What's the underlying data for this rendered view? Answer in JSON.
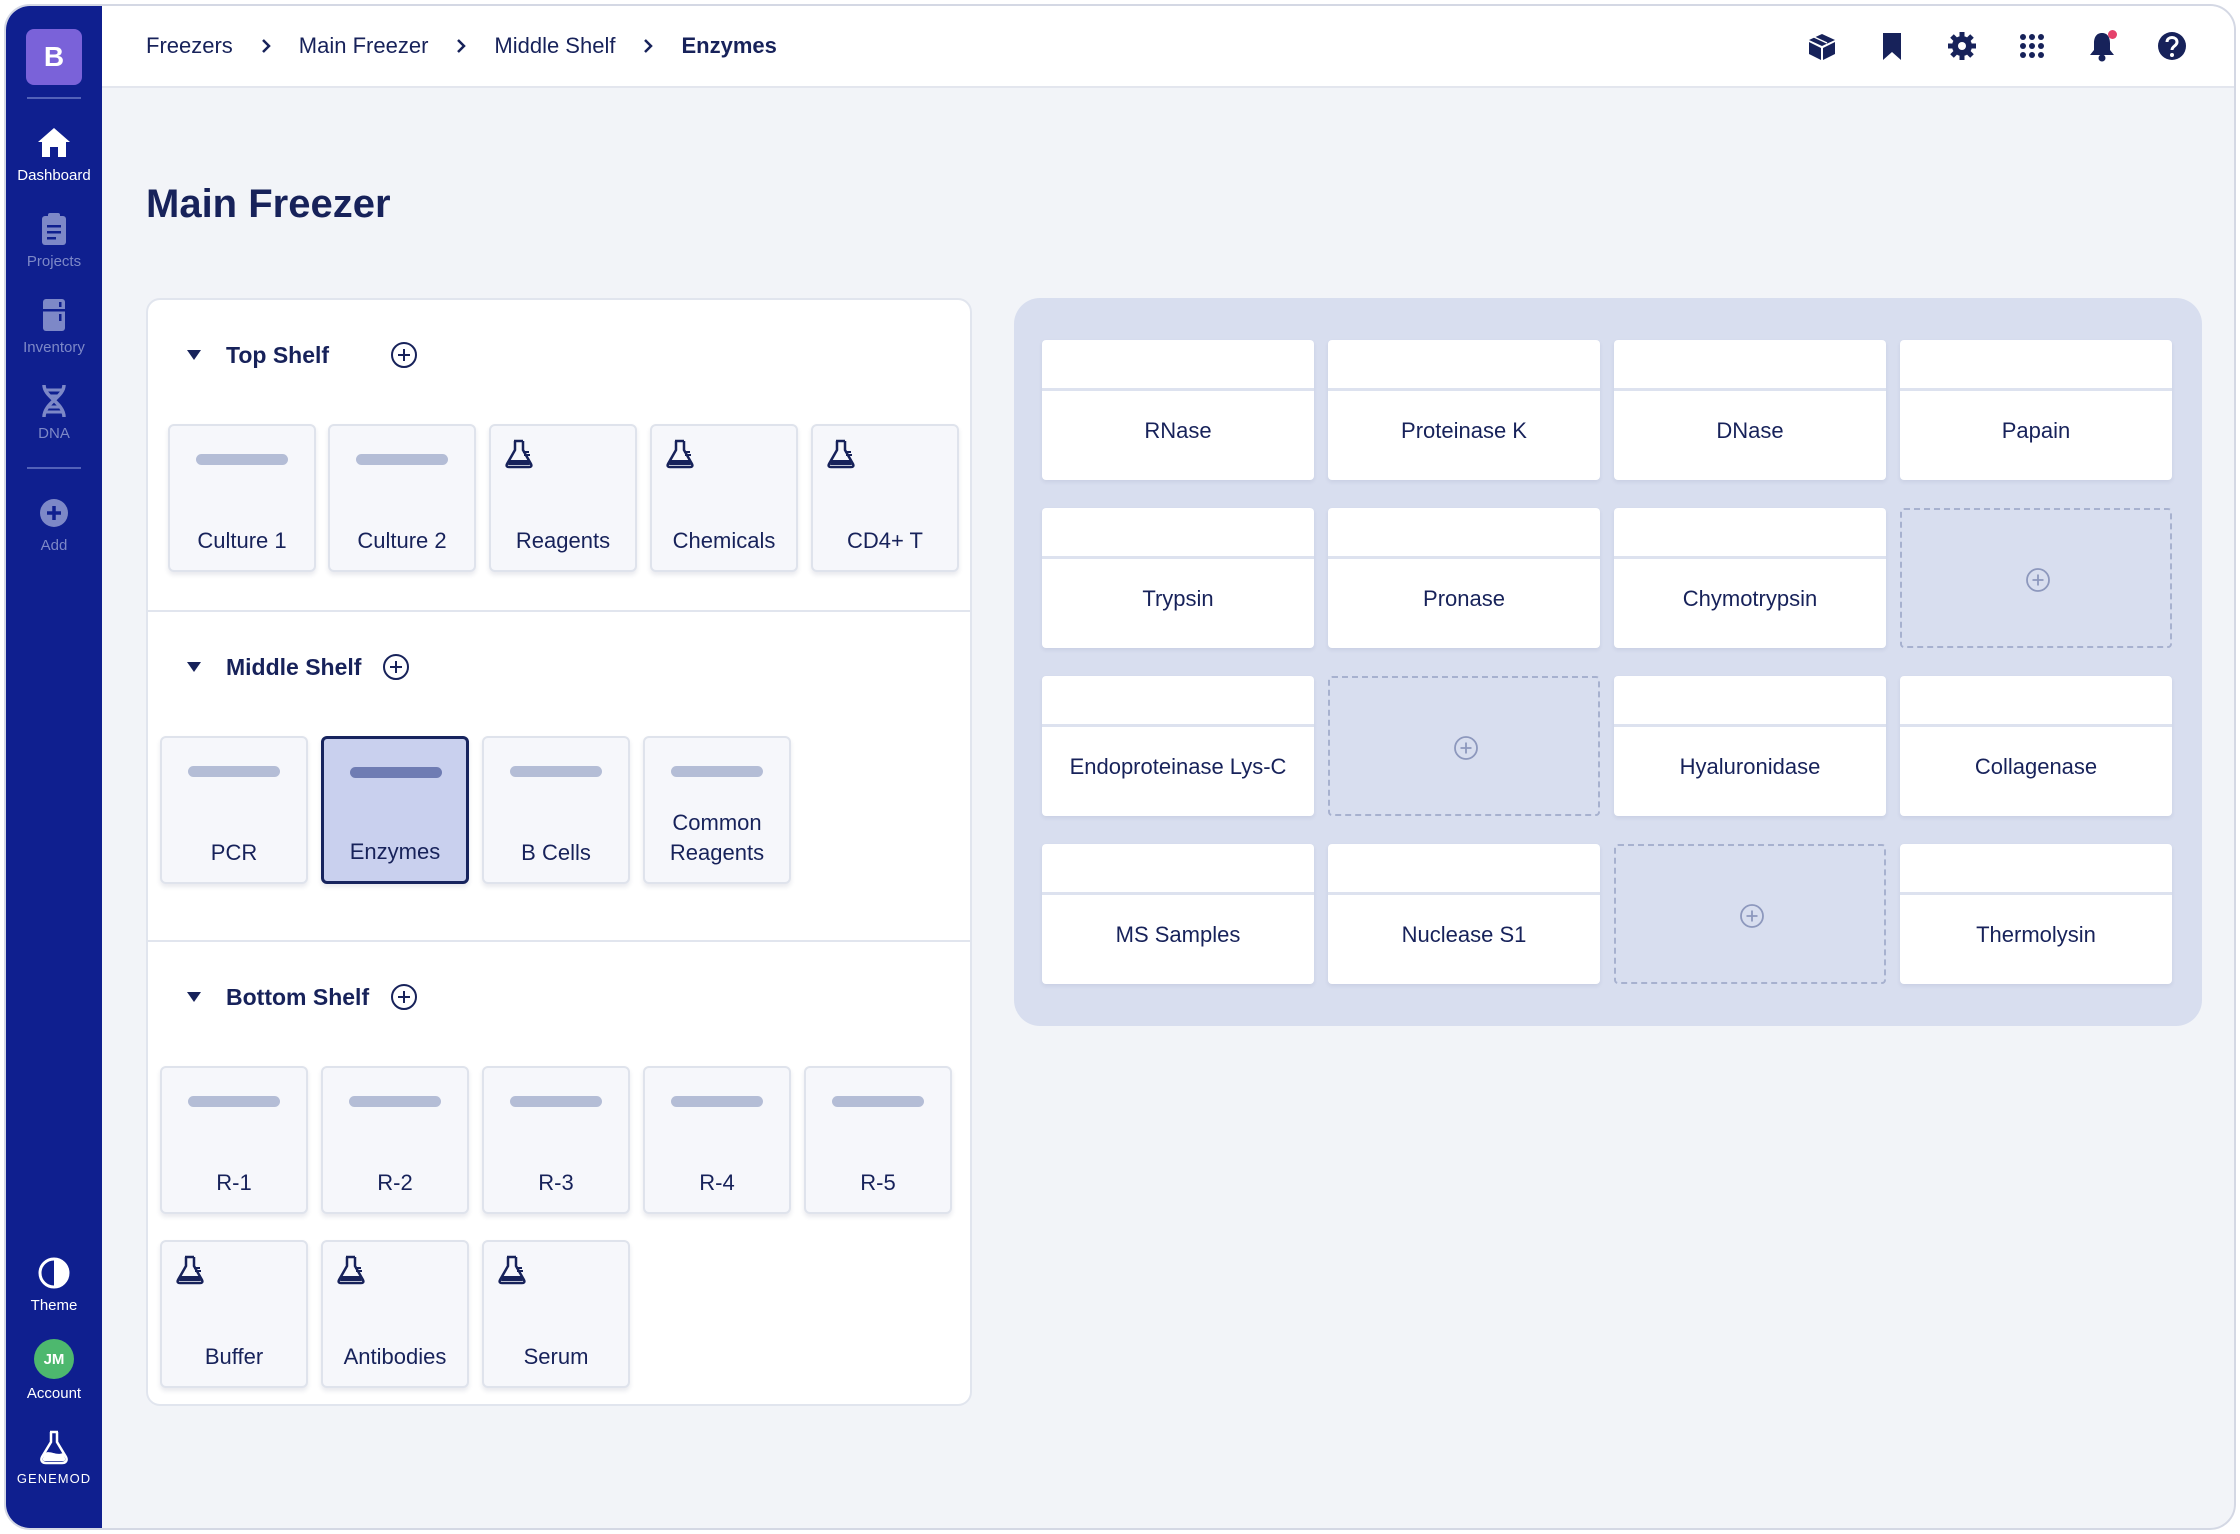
{
  "sidebar": {
    "logo": "B",
    "nav": [
      {
        "id": "dashboard",
        "label": "Dashboard",
        "active": true
      },
      {
        "id": "projects",
        "label": "Projects",
        "active": false
      },
      {
        "id": "inventory",
        "label": "Inventory",
        "active": false
      },
      {
        "id": "dna",
        "label": "DNA",
        "active": false
      },
      {
        "id": "add",
        "label": "Add",
        "active": false
      }
    ],
    "bottom": {
      "theme_label": "Theme",
      "account_initials": "JM",
      "account_label": "Account",
      "brand_label": "GENEMOD"
    }
  },
  "breadcrumb": [
    "Freezers",
    "Main Freezer",
    "Middle Shelf",
    "Enzymes"
  ],
  "header_icons": [
    "box-icon",
    "bookmark-icon",
    "gear-icon",
    "apps-grid-icon",
    "bell-icon",
    "help-icon"
  ],
  "page": {
    "title": "Main Freezer"
  },
  "shelves": [
    {
      "name": "Top Shelf",
      "boxes": [
        {
          "label": "Culture 1",
          "icon": "bar"
        },
        {
          "label": "Culture 2",
          "icon": "bar"
        },
        {
          "label": "Reagents",
          "icon": "flask"
        },
        {
          "label": "Chemicals",
          "icon": "flask"
        },
        {
          "label": "CD4+ T",
          "icon": "flask"
        }
      ]
    },
    {
      "name": "Middle Shelf",
      "boxes": [
        {
          "label": "PCR",
          "icon": "bar"
        },
        {
          "label": "Enzymes",
          "icon": "bar",
          "selected": true
        },
        {
          "label": "B Cells",
          "icon": "bar"
        },
        {
          "label": "Common Reagents",
          "icon": "bar"
        }
      ]
    },
    {
      "name": "Bottom Shelf",
      "boxes": [
        {
          "label": "R-1",
          "icon": "bar"
        },
        {
          "label": "R-2",
          "icon": "bar"
        },
        {
          "label": "R-3",
          "icon": "bar"
        },
        {
          "label": "R-4",
          "icon": "bar"
        },
        {
          "label": "R-5",
          "icon": "bar"
        },
        {
          "label": "Buffer",
          "icon": "flask"
        },
        {
          "label": "Antibodies",
          "icon": "flask"
        },
        {
          "label": "Serum",
          "icon": "flask"
        }
      ]
    }
  ],
  "grid": {
    "rows": [
      [
        "RNase",
        "Proteinase K",
        "DNase",
        "Papain"
      ],
      [
        "Trypsin",
        "Pronase",
        "Chymotrypsin",
        null
      ],
      [
        "Endoproteinase Lys-C",
        null,
        "Hyaluronidase",
        "Collagenase"
      ],
      [
        "MS Samples",
        "Nuclease S1",
        null,
        "Thermolysin"
      ]
    ]
  },
  "colors": {
    "sidebar": "#0f1f8f",
    "logo": "#7a62d9",
    "text": "#17225a",
    "selected_box": "#c9d0ee",
    "grid_panel": "#d8deef",
    "avatar": "#4db86e",
    "notification": "#e5426b"
  }
}
